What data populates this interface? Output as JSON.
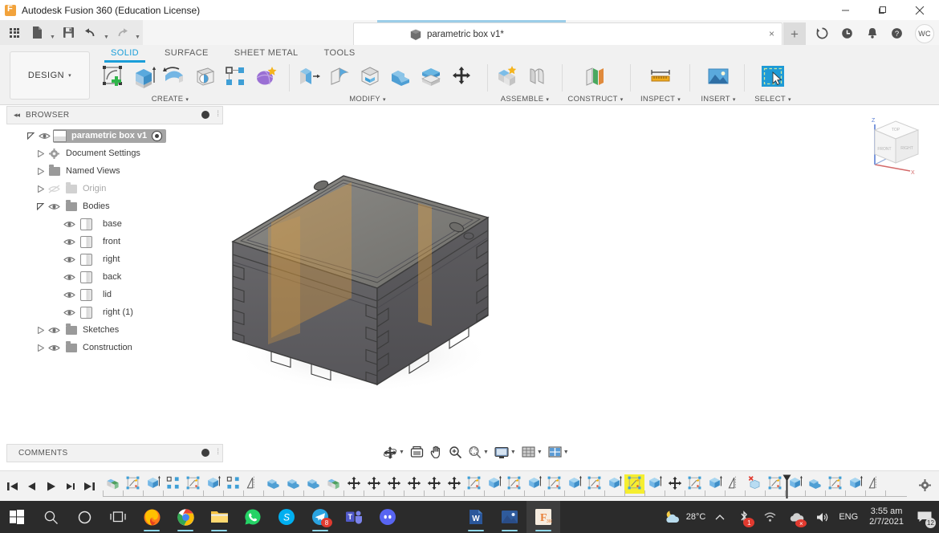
{
  "window": {
    "title": "Autodesk Fusion 360 (Education License)",
    "app_icon": "fusion-logo-icon",
    "minimize": "minimize-icon",
    "maximize": "restore-icon",
    "close": "close-icon"
  },
  "quick_access": {
    "show_data_panel": "grid-icon",
    "file": "file-icon",
    "save": "save-icon",
    "undo": "undo-icon",
    "redo": "redo-icon"
  },
  "document_tabs": {
    "active": {
      "label": "parametric box v1*",
      "icon": "component-cube-icon",
      "close": "close-icon"
    },
    "new_tab": "+",
    "right_icons": [
      {
        "name": "job-status-icon",
        "glyph": "refresh"
      },
      {
        "name": "recent-activity-icon",
        "glyph": "clock"
      },
      {
        "name": "notifications-icon",
        "glyph": "bell"
      },
      {
        "name": "help-icon",
        "glyph": "question"
      }
    ],
    "account_initials": "WC"
  },
  "ribbon": {
    "workspace_button": {
      "label": "DESIGN",
      "caret": "▾"
    },
    "tabs": [
      {
        "label": "SOLID",
        "active": true
      },
      {
        "label": "SURFACE",
        "active": false
      },
      {
        "label": "SHEET METAL",
        "active": false
      },
      {
        "label": "TOOLS",
        "active": false
      }
    ],
    "groups": [
      {
        "label": "CREATE",
        "caret": "▾",
        "tools": [
          "create-sketch-icon",
          "extrude-icon",
          "revolve-icon",
          "hole-icon",
          "pattern-icon",
          "form-icon"
        ]
      },
      {
        "label": "MODIFY",
        "caret": "▾",
        "tools": [
          "press-pull-icon",
          "fillet-icon",
          "shell-icon",
          "combine-icon",
          "split-body-icon",
          "move-copy-icon"
        ]
      },
      {
        "label": "ASSEMBLE",
        "caret": "▾",
        "tools": [
          "new-component-icon",
          "joint-icon"
        ]
      },
      {
        "label": "CONSTRUCT",
        "caret": "▾",
        "tools": [
          "offset-plane-icon"
        ]
      },
      {
        "label": "INSPECT",
        "caret": "▾",
        "tools": [
          "measure-icon"
        ]
      },
      {
        "label": "INSERT",
        "caret": "▾",
        "tools": [
          "insert-canvas-icon"
        ]
      },
      {
        "label": "SELECT",
        "caret": "▾",
        "tools": [
          "select-window-icon"
        ]
      }
    ]
  },
  "browser": {
    "title": "BROWSER",
    "collapse": "◂◂",
    "settings_dot": "panel-dot-icon",
    "tree": [
      {
        "label": "parametric box v1",
        "indent": 0,
        "arrow": "expanded",
        "eye": true,
        "icon": "component-icon",
        "root": true,
        "activate_radio": true
      },
      {
        "label": "Document Settings",
        "indent": 1,
        "arrow": "collapsed",
        "eye": false,
        "icon": "gear-icon"
      },
      {
        "label": "Named Views",
        "indent": 1,
        "arrow": "collapsed",
        "eye": false,
        "icon": "folder-icon"
      },
      {
        "label": "Origin",
        "indent": 1,
        "arrow": "collapsed",
        "eye": true,
        "eye_off": true,
        "icon": "folder-icon"
      },
      {
        "label": "Bodies",
        "indent": 1,
        "arrow": "expanded",
        "eye": true,
        "icon": "folder-icon"
      },
      {
        "label": "base",
        "indent": 2,
        "arrow": "none",
        "eye": true,
        "icon": "body-icon"
      },
      {
        "label": "front",
        "indent": 2,
        "arrow": "none",
        "eye": true,
        "icon": "body-icon"
      },
      {
        "label": "right",
        "indent": 2,
        "arrow": "none",
        "eye": true,
        "icon": "body-icon"
      },
      {
        "label": "back",
        "indent": 2,
        "arrow": "none",
        "eye": true,
        "icon": "body-icon"
      },
      {
        "label": "lid",
        "indent": 2,
        "arrow": "none",
        "eye": true,
        "icon": "body-icon"
      },
      {
        "label": "right (1)",
        "indent": 2,
        "arrow": "none",
        "eye": true,
        "icon": "body-icon"
      },
      {
        "label": "Sketches",
        "indent": 1,
        "arrow": "collapsed",
        "eye": true,
        "icon": "folder-icon"
      },
      {
        "label": "Construction",
        "indent": 1,
        "arrow": "collapsed",
        "eye": true,
        "icon": "folder-icon"
      }
    ]
  },
  "comments": {
    "title": "COMMENTS",
    "settings_dot": "panel-dot-icon"
  },
  "canvas": {
    "model_name": "parametric-box-finger-joint",
    "background": "#ffffff",
    "body_color": "#6e6d6a",
    "plane_color": "#e8a33d",
    "view_cube": {
      "top": "TOP",
      "front": "FRONT",
      "right": "RIGHT",
      "axis_z": "Z",
      "axis_x": "X"
    }
  },
  "navbar": [
    {
      "name": "orbit-icon",
      "caret": true
    },
    {
      "name": "look-at-icon",
      "caret": false
    },
    {
      "name": "pan-icon",
      "caret": false
    },
    {
      "name": "zoom-icon",
      "caret": false
    },
    {
      "name": "zoom-window-icon",
      "caret": true
    },
    {
      "name": "display-settings-icon",
      "caret": true
    },
    {
      "name": "grid-snaps-icon",
      "caret": true
    },
    {
      "name": "viewports-icon",
      "caret": true
    }
  ],
  "timeline": {
    "playback": [
      "go-to-beginning-icon",
      "step-back-icon",
      "play-icon",
      "step-forward-icon",
      "go-to-end-icon"
    ],
    "settings": "gear-icon",
    "selected_index": 26,
    "features": [
      "new-component-icon",
      "sketch-icon",
      "extrude-icon",
      "pattern-icon",
      "sketch-icon",
      "extrude-icon",
      "pattern-icon",
      "mirror-icon",
      "combine-icon",
      "combine-icon",
      "combine-icon",
      "new-component-icon",
      "move-icon",
      "move-icon",
      "move-icon",
      "move-icon",
      "move-icon",
      "move-icon",
      "sketch-icon",
      "extrude-icon",
      "sketch-icon",
      "extrude-icon",
      "sketch-icon",
      "extrude-icon",
      "sketch-icon",
      "extrude-icon",
      "sketch-icon",
      "extrude-icon",
      "move-icon",
      "sketch-icon",
      "extrude-icon",
      "mirror-icon",
      "delete-icon",
      "sketch-icon",
      "extrude-icon",
      "combine-icon",
      "sketch-icon",
      "extrude-icon",
      "mirror-icon"
    ]
  },
  "taskbar": {
    "apps": [
      {
        "name": "start-button-icon",
        "running": false
      },
      {
        "name": "search-icon",
        "running": false
      },
      {
        "name": "cortana-icon",
        "running": false
      },
      {
        "name": "task-view-icon",
        "running": false
      },
      {
        "name": "firefox-icon",
        "running": true
      },
      {
        "name": "chrome-icon",
        "running": true
      },
      {
        "name": "file-explorer-icon",
        "running": true
      },
      {
        "name": "whatsapp-icon",
        "running": false
      },
      {
        "name": "skype-icon",
        "running": false
      },
      {
        "name": "telegram-icon",
        "running": true,
        "badge": "8"
      },
      {
        "name": "microsoft-teams-icon",
        "running": false
      },
      {
        "name": "discord-icon",
        "running": false
      },
      {
        "name": "microsoft-word-icon",
        "running": true
      },
      {
        "name": "photos-icon",
        "running": true
      },
      {
        "name": "fusion360-icon",
        "running": true,
        "active": true
      }
    ],
    "tray": {
      "weather_icon": "partly-cloudy-night-icon",
      "temperature": "28°C",
      "chevron": "show-hidden-icons-icon",
      "bluetooth_badge": "1",
      "network_icon": "wifi-icon",
      "cloud_icon": "onedrive-offline-icon",
      "volume_icon": "speaker-icon",
      "language": "ENG",
      "time": "3:55 am",
      "date": "2/7/2021",
      "notifications_count": "12"
    }
  }
}
